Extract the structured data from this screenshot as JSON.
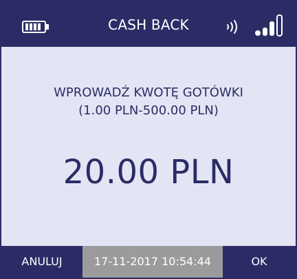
{
  "header": {
    "title": "CASH BACK",
    "battery_icon": "battery-icon",
    "contactless_icon": "contactless-icon",
    "signal_icon": "signal-icon"
  },
  "main": {
    "prompt_line1": "WPROWADŹ KWOTĘ GOTÓWKI",
    "prompt_line2": "(1.00 PLN-500.00 PLN)",
    "amount": "20.00 PLN"
  },
  "footer": {
    "cancel_label": "ANULUJ",
    "datetime": "17-11-2017 10:54:44",
    "ok_label": "OK"
  },
  "colors": {
    "primary": "#2b2c66",
    "background": "#e3e5f4",
    "datetime_bg": "#9b9b9e"
  }
}
